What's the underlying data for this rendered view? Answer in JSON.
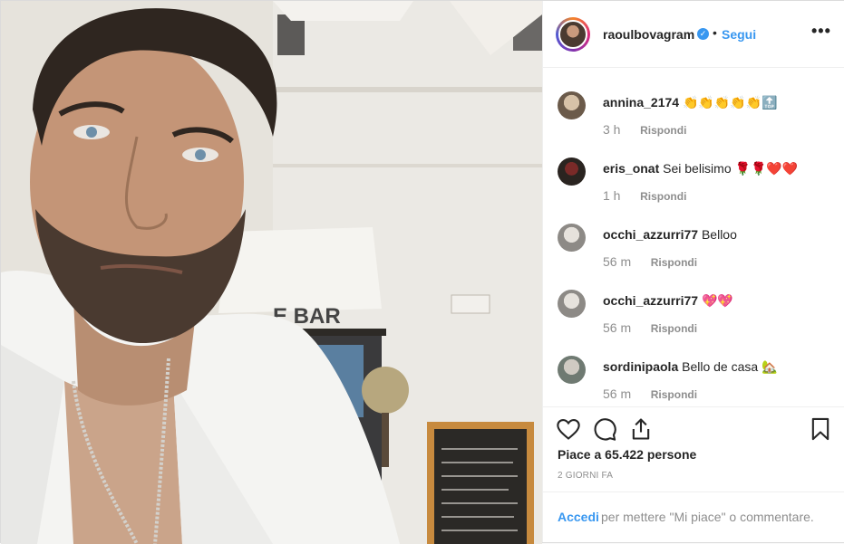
{
  "header": {
    "username": "raoulbovagram",
    "verified_glyph": "✓",
    "separator": "•",
    "follow_label": "Segui",
    "more_label": "•••"
  },
  "comments": [
    {
      "user": "annina_2174",
      "text": "👏👏👏👏👏🔝",
      "time": "3 h",
      "reply": "Rispondi"
    },
    {
      "user": "eris_onat",
      "text": "Sei belisimo 🌹🌹❤️❤️",
      "time": "1 h",
      "reply": "Rispondi"
    },
    {
      "user": "occhi_azzurri77",
      "text": "Belloo",
      "time": "56 m",
      "reply": "Rispondi"
    },
    {
      "user": "occhi_azzurri77",
      "text": "💖💖",
      "time": "56 m",
      "reply": "Rispondi"
    },
    {
      "user": "sordinipaola",
      "text": "Bello de casa 🏡",
      "time": "56 m",
      "reply": "Rispondi"
    }
  ],
  "actions": {
    "icons": [
      "heart-icon",
      "comment-icon",
      "share-icon",
      "bookmark-icon"
    ],
    "likes": "Piace a 65.422 persone",
    "date": "2 GIORNI FA"
  },
  "login": {
    "link": "Accedi",
    "text": "per mettere \"Mi piace\" o commentare."
  },
  "colors": {
    "accent": "#3897f0",
    "text": "#262626",
    "muted": "#8e8e8e",
    "border": "#efefef"
  }
}
